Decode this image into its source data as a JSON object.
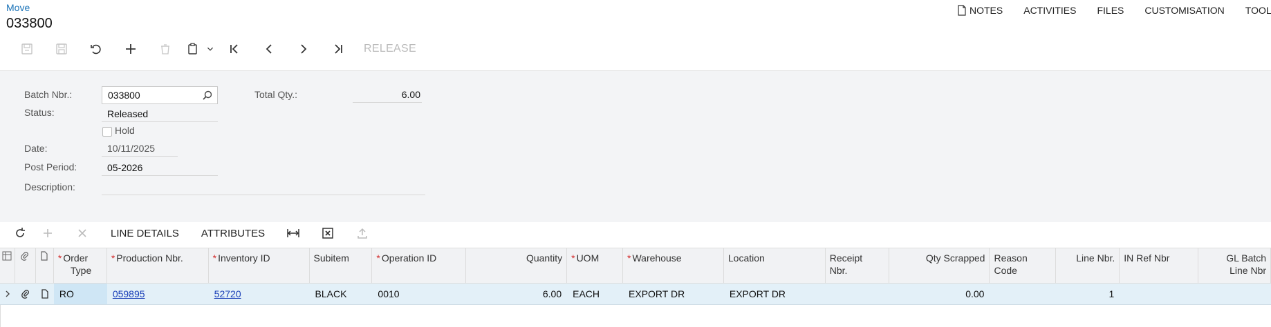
{
  "header": {
    "breadcrumb": "Move",
    "title": "033800"
  },
  "top_menu": {
    "notes": "NOTES",
    "activities": "ACTIVITIES",
    "files": "FILES",
    "customisation": "CUSTOMISATION",
    "tools": "TOOLS"
  },
  "toolbar": {
    "release": "RELEASE",
    "icons": [
      "save-close-icon",
      "save-icon",
      "undo-icon",
      "add-icon",
      "delete-icon",
      "copy-paste-icon",
      "chevron-down-icon",
      "first-icon",
      "previous-icon",
      "next-icon",
      "last-icon"
    ]
  },
  "form": {
    "batch_nbr_label": "Batch Nbr.:",
    "batch_nbr_value": "033800",
    "status_label": "Status:",
    "status_value": "Released",
    "hold_label": "Hold",
    "date_label": "Date:",
    "date_value": "10/11/2025",
    "post_period_label": "Post Period:",
    "post_period_value": "05-2026",
    "description_label": "Description:",
    "description_value": "",
    "total_qty_label": "Total Qty.:",
    "total_qty_value": "6.00"
  },
  "grid_toolbar": {
    "line_details": "LINE DETAILS",
    "attributes": "ATTRIBUTES"
  },
  "grid": {
    "columns": {
      "order_type": [
        "Order",
        "Type"
      ],
      "production_nbr": "Production Nbr.",
      "inventory_id": "Inventory ID",
      "subitem": "Subitem",
      "operation_id": "Operation ID",
      "quantity": "Quantity",
      "uom": "UOM",
      "warehouse": "Warehouse",
      "location": "Location",
      "receipt_nbr": [
        "Receipt",
        "Nbr."
      ],
      "qty_scrapped": "Qty Scrapped",
      "reason_code": [
        "Reason",
        "Code"
      ],
      "line_nbr": "Line Nbr.",
      "in_ref_nbr": "IN Ref Nbr",
      "gl_batch": [
        "GL Batch",
        "Line Nbr"
      ]
    },
    "rows": [
      {
        "order_type": "RO",
        "production_nbr": "059895",
        "inventory_id": "52720",
        "subitem": "BLACK",
        "operation_id": "0010",
        "quantity": "6.00",
        "uom": "EACH",
        "warehouse": "EXPORT DR",
        "location": "EXPORT DR",
        "receipt_nbr": "",
        "qty_scrapped": "0.00",
        "reason_code": "",
        "line_nbr": "1",
        "in_ref_nbr": "",
        "gl_batch": ""
      }
    ]
  },
  "colors": {
    "link": "#1a3fb8",
    "breadcrumb": "#1a73b8",
    "required": "#d32f2f",
    "row_selected": "#e3f0f8"
  }
}
